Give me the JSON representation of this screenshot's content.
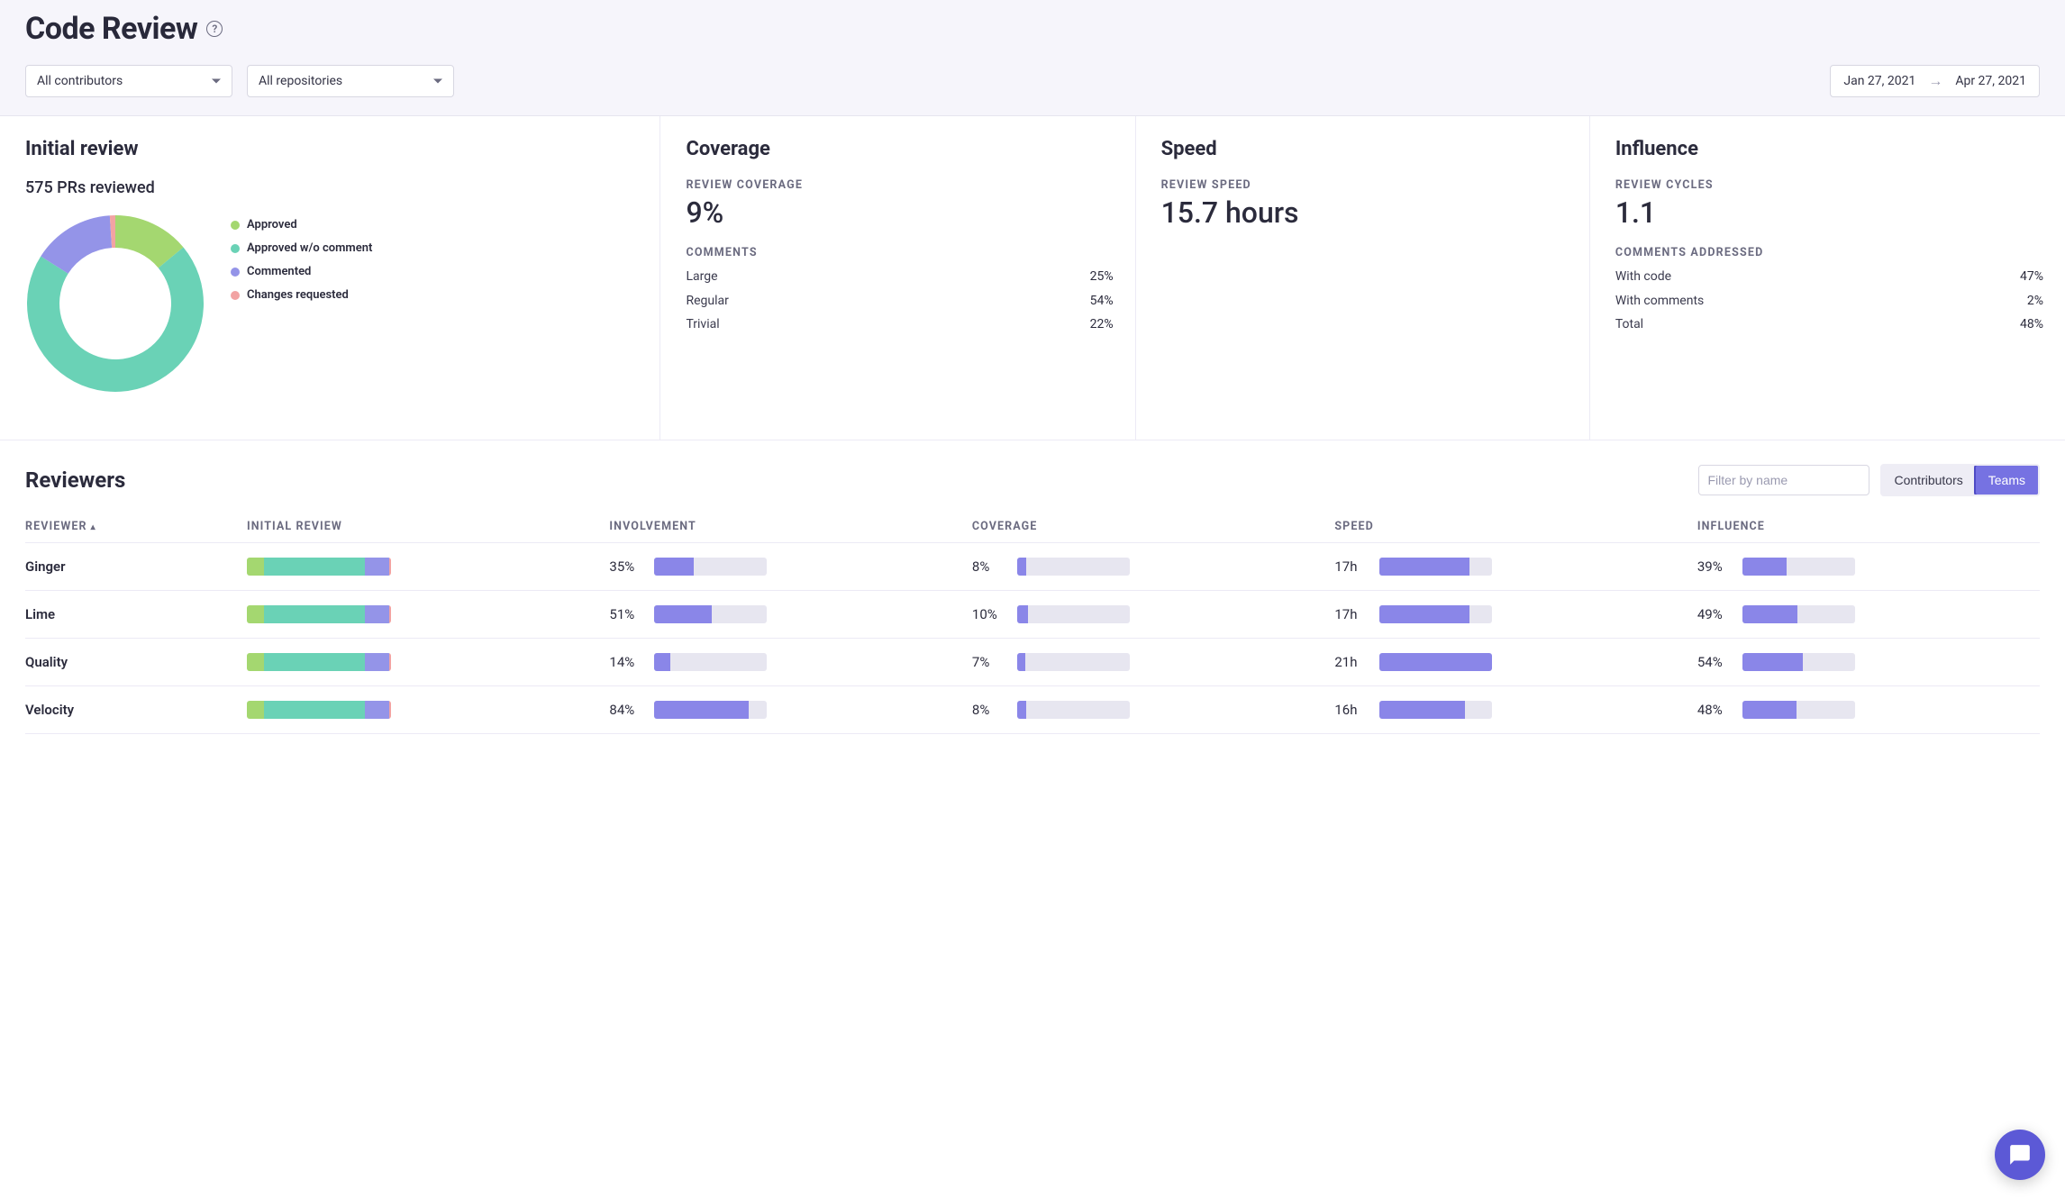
{
  "header": {
    "title": "Code Review",
    "contributors_select": "All contributors",
    "repositories_select": "All repositories",
    "date_from": "Jan 27, 2021",
    "date_to": "Apr 27, 2021"
  },
  "colors": {
    "approved": "#a4d770",
    "approved_no_comment": "#6ad2b6",
    "commented": "#9494e8",
    "changes_requested": "#f2a3a3",
    "bar_fill": "#8a86e8",
    "bar_track": "#e7e6f0"
  },
  "initial_review": {
    "title": "Initial review",
    "subtitle": "575 PRs reviewed",
    "legend": [
      {
        "label": "Approved",
        "color_key": "approved"
      },
      {
        "label": "Approved w/o comment",
        "color_key": "approved_no_comment"
      },
      {
        "label": "Commented",
        "color_key": "commented"
      },
      {
        "label": "Changes requested",
        "color_key": "changes_requested"
      }
    ]
  },
  "coverage": {
    "title": "Coverage",
    "metric_label": "REVIEW COVERAGE",
    "metric_value": "9%",
    "comments_label": "COMMENTS",
    "comments": [
      {
        "k": "Large",
        "v": "25%"
      },
      {
        "k": "Regular",
        "v": "54%"
      },
      {
        "k": "Trivial",
        "v": "22%"
      }
    ]
  },
  "speed": {
    "title": "Speed",
    "metric_label": "REVIEW SPEED",
    "metric_value": "15.7 hours"
  },
  "influence": {
    "title": "Influence",
    "metric_label": "REVIEW CYCLES",
    "metric_value": "1.1",
    "addressed_label": "COMMENTS ADDRESSED",
    "addressed": [
      {
        "k": "With code",
        "v": "47%"
      },
      {
        "k": "With comments",
        "v": "2%"
      },
      {
        "k": "Total",
        "v": "48%"
      }
    ]
  },
  "reviewers": {
    "section_title": "Reviewers",
    "filter_placeholder": "Filter by name",
    "toggle_contributors": "Contributors",
    "toggle_teams": "Teams",
    "columns": {
      "reviewer": "REVIEWER",
      "initial_review": "INITIAL REVIEW",
      "involvement": "INVOLVEMENT",
      "coverage": "COVERAGE",
      "speed": "SPEED",
      "influence": "INFLUENCE"
    },
    "rows": [
      {
        "name": "Ginger",
        "initial_review": {
          "approved": 12,
          "approved_no_comment": 70,
          "commented": 17,
          "changes_requested": 1
        },
        "involvement": {
          "text": "35%",
          "fill": 35
        },
        "coverage": {
          "text": "8%",
          "fill": 8
        },
        "speed": {
          "text": "17h",
          "fill": 80
        },
        "influence": {
          "text": "39%",
          "fill": 39
        }
      },
      {
        "name": "Lime",
        "initial_review": {
          "approved": 12,
          "approved_no_comment": 70,
          "commented": 17,
          "changes_requested": 1
        },
        "involvement": {
          "text": "51%",
          "fill": 51
        },
        "coverage": {
          "text": "10%",
          "fill": 10
        },
        "speed": {
          "text": "17h",
          "fill": 80
        },
        "influence": {
          "text": "49%",
          "fill": 49
        }
      },
      {
        "name": "Quality",
        "initial_review": {
          "approved": 12,
          "approved_no_comment": 70,
          "commented": 17,
          "changes_requested": 1
        },
        "involvement": {
          "text": "14%",
          "fill": 14
        },
        "coverage": {
          "text": "7%",
          "fill": 7
        },
        "speed": {
          "text": "21h",
          "fill": 100
        },
        "influence": {
          "text": "54%",
          "fill": 54
        }
      },
      {
        "name": "Velocity",
        "initial_review": {
          "approved": 12,
          "approved_no_comment": 70,
          "commented": 17,
          "changes_requested": 1
        },
        "involvement": {
          "text": "84%",
          "fill": 84
        },
        "coverage": {
          "text": "8%",
          "fill": 8
        },
        "speed": {
          "text": "16h",
          "fill": 76
        },
        "influence": {
          "text": "48%",
          "fill": 48
        }
      }
    ]
  },
  "chart_data": {
    "type": "pie",
    "title": "Initial review — 575 PRs reviewed",
    "series": [
      {
        "name": "Approved",
        "value": 14
      },
      {
        "name": "Approved w/o comment",
        "value": 70
      },
      {
        "name": "Commented",
        "value": 15
      },
      {
        "name": "Changes requested",
        "value": 1
      }
    ]
  }
}
